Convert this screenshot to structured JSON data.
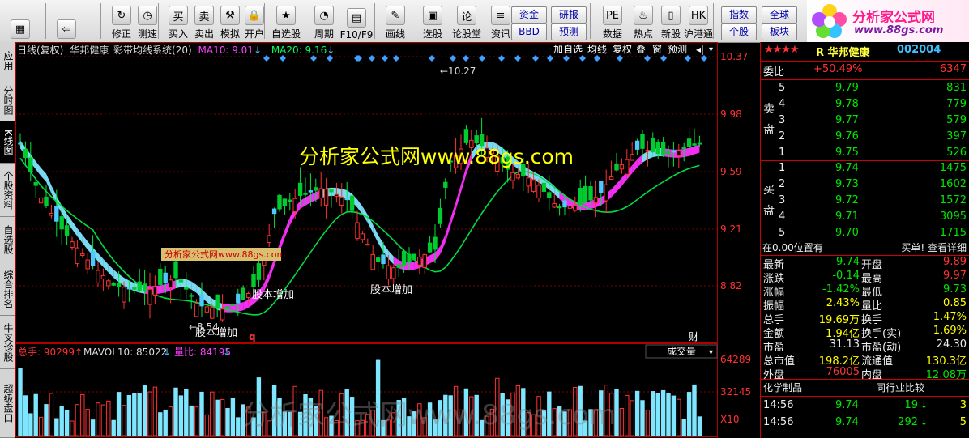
{
  "toolbar": {
    "buttons": [
      {
        "label": "",
        "icon": "grid-icon",
        "x": 5
      },
      {
        "label": "",
        "icon": "back-arrow-icon",
        "x": 62
      },
      {
        "label": "修正",
        "icon": "adjust-icon",
        "x": 130
      },
      {
        "label": "测速",
        "icon": "clock-icon",
        "x": 162
      },
      {
        "label": "买入",
        "icon": "buy-icon",
        "x": 200
      },
      {
        "label": "卖出",
        "icon": "sell-icon",
        "x": 232
      },
      {
        "label": "模拟",
        "icon": "hammer-icon",
        "x": 264
      },
      {
        "label": "开户",
        "icon": "lock-icon",
        "x": 294
      },
      {
        "label": "自选股",
        "icon": "star-icon",
        "x": 333
      },
      {
        "label": "周期",
        "icon": "cycle-icon",
        "x": 380
      },
      {
        "label": "F10/F9",
        "icon": "f10-icon",
        "x": 420
      },
      {
        "label": "画线",
        "icon": "pen-icon",
        "x": 468
      },
      {
        "label": "选股",
        "icon": "select-icon",
        "x": 514
      },
      {
        "label": "论股堂",
        "icon": "forum-icon",
        "x": 556
      },
      {
        "label": "资讯",
        "icon": "news-icon",
        "x": 598
      },
      {
        "label": "数据",
        "icon": "pe-icon",
        "x": 736
      },
      {
        "label": "热点",
        "icon": "hot-icon",
        "x": 774
      },
      {
        "label": "新股",
        "icon": "newstock-icon",
        "x": 808
      },
      {
        "label": "沪港通",
        "icon": "hk-icon",
        "x": 842
      }
    ],
    "small_buttons": [
      {
        "label": "资金",
        "x": 631,
        "y": 8
      },
      {
        "label": "研报",
        "x": 680,
        "y": 8
      },
      {
        "label": "BBD",
        "x": 631,
        "y": 29
      },
      {
        "label": "预测",
        "x": 680,
        "y": 29
      },
      {
        "label": "指数",
        "x": 890,
        "y": 8
      },
      {
        "label": "全球",
        "x": 940,
        "y": 8
      },
      {
        "label": "个股",
        "x": 890,
        "y": 29
      },
      {
        "label": "板块",
        "x": 940,
        "y": 29
      }
    ]
  },
  "logo": {
    "title": "分析家公式网",
    "url": "www.88gs.com"
  },
  "sidetabs": [
    {
      "label": "应用",
      "h": 46,
      "active": false
    },
    {
      "label": "分时图",
      "h": 52,
      "active": false
    },
    {
      "label": "K线图",
      "h": 52,
      "active": true
    },
    {
      "label": "个股资料",
      "h": 66,
      "active": false
    },
    {
      "label": "自选股",
      "h": 56,
      "active": false
    },
    {
      "label": "综合排名",
      "h": 66,
      "active": false
    },
    {
      "label": "牛叉诊股",
      "h": 66,
      "active": false
    },
    {
      "label": "超级盘口",
      "h": 85,
      "active": false
    }
  ],
  "chart": {
    "info_period": "日线(复权)",
    "info_name": "华邦健康",
    "info_indicator": "彩带均线系统(20)",
    "ma10_label": "MA10: 9.01",
    "ma20_label": "MA20: 9.16",
    "menu": [
      "加自选",
      "均线",
      "复权",
      "叠",
      "窗",
      "预测"
    ],
    "yticks": [
      "10.37",
      "9.98",
      "9.59",
      "9.21",
      "8.82"
    ],
    "watermark": "分析家公式网www.88gs.com",
    "watermark_small": "分析家公式网www.88gs.com",
    "high_label": "10.27",
    "low_label": "8.54",
    "annotations": [
      "股本增加",
      "股本增加",
      "股本增加"
    ],
    "q_label": "q",
    "cai_label": "财",
    "vol_info_total": "总手: 90299",
    "vol_info_ma": "MAVOL10: 85022",
    "vol_info_ratio": "量比: 84195",
    "vol_dropdown": "成交量",
    "vol_yticks": [
      "64289",
      "32145",
      "X10"
    ],
    "vol_watermark": "分析家公式网www.88gs.com"
  },
  "chart_data": {
    "type": "candlestick",
    "ylim": [
      8.45,
      10.45
    ],
    "series": [
      {
        "name": "MA10",
        "value": 9.01
      },
      {
        "name": "MA20",
        "value": 9.16
      }
    ]
  },
  "quote": {
    "stars": "★★★★",
    "title": "R 华邦健康",
    "code": "002004",
    "weibi_label": "委比",
    "weibi": "+50.49%",
    "weicha": "6347",
    "sell_label": "卖盘",
    "buy_label": "买盘",
    "asks": [
      {
        "lvl": "5",
        "price": "9.79",
        "vol": "831"
      },
      {
        "lvl": "4",
        "price": "9.78",
        "vol": "779"
      },
      {
        "lvl": "3",
        "price": "9.77",
        "vol": "579"
      },
      {
        "lvl": "2",
        "price": "9.76",
        "vol": "397"
      },
      {
        "lvl": "1",
        "price": "9.75",
        "vol": "526"
      }
    ],
    "bids": [
      {
        "lvl": "1",
        "price": "9.74",
        "vol": "1475"
      },
      {
        "lvl": "2",
        "price": "9.73",
        "vol": "1602"
      },
      {
        "lvl": "3",
        "price": "9.72",
        "vol": "1572"
      },
      {
        "lvl": "4",
        "price": "9.71",
        "vol": "3095"
      },
      {
        "lvl": "5",
        "price": "9.70",
        "vol": "1715"
      }
    ],
    "status_left": "在0.00位置有",
    "status_right": "买单! 查看详细",
    "stats": [
      {
        "k1": "最新",
        "v1": "9.74",
        "c1": "grn",
        "k2": "开盘",
        "v2": "9.89",
        "c2": "red"
      },
      {
        "k1": "涨跌",
        "v1": "-0.14",
        "c1": "grn",
        "k2": "最高",
        "v2": "9.97",
        "c2": "red"
      },
      {
        "k1": "涨幅",
        "v1": "-1.42%",
        "c1": "grn",
        "k2": "最低",
        "v2": "9.73",
        "c2": "grn"
      },
      {
        "k1": "振幅",
        "v1": "2.43%",
        "c1": "yel",
        "k2": "量比",
        "v2": "0.85",
        "c2": "yel"
      },
      {
        "k1": "总手",
        "v1": "19.69万",
        "c1": "yel",
        "k2": "换手",
        "v2": "1.47%",
        "c2": "yel"
      },
      {
        "k1": "金额",
        "v1": "1.94亿",
        "c1": "yel",
        "k2": "换手(实)",
        "v2": "1.69%",
        "c2": "yel"
      },
      {
        "k1": "市盈",
        "v1": "31.13",
        "c1": "wht",
        "k2": "市盈(动)",
        "v2": "24.30",
        "c2": "wht"
      },
      {
        "k1": "总市值",
        "v1": "198.2亿",
        "c1": "yel",
        "k2": "流通值",
        "v2": "130.3亿",
        "c2": "yel"
      },
      {
        "k1": "外盘",
        "v1": "76005",
        "c1": "red",
        "k2": "内盘",
        "v2": "12.08万",
        "c2": "grn"
      }
    ],
    "sector_left": "化学制品",
    "sector_right": "同行业比较",
    "ticks": [
      {
        "time": "14:56",
        "price": "9.74",
        "vol": "19",
        "dir": "↓",
        "n": "3"
      },
      {
        "time": "14:56",
        "price": "9.74",
        "vol": "292",
        "dir": "↓",
        "n": "5"
      }
    ]
  }
}
